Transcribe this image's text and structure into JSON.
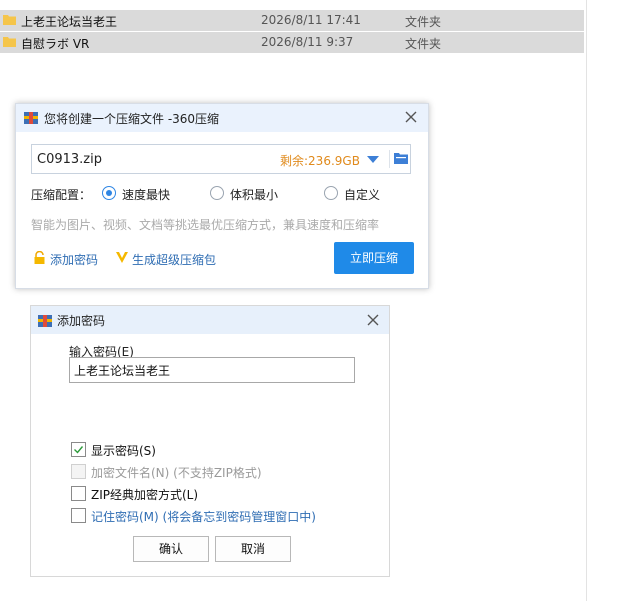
{
  "files": [
    {
      "name": "上老王论坛当老王",
      "date": "2026/8/11 17:41",
      "type": "文件夹"
    },
    {
      "name": "自慰ラボ VR",
      "date": "2026/8/11 9:37",
      "type": "文件夹"
    }
  ],
  "compress_dialog": {
    "title": "您将创建一个压缩文件 -360压缩",
    "filename": "C0913.zip",
    "free_space": "剩余:236.9GB",
    "config_label": "压缩配置：",
    "options": [
      "速度最快",
      "体积最小",
      "自定义"
    ],
    "selected_option": "速度最快",
    "hint": "智能为图片、视频、文档等挑选最优压缩方式，兼具速度和压缩率",
    "add_password": "添加密码",
    "super_package": "生成超级压缩包",
    "compress_now": "立即压缩"
  },
  "password_dialog": {
    "title": "添加密码",
    "input_label": "输入密码(E)",
    "password_value": "上老王论坛当老王",
    "show_password": {
      "label": "显示密码(S)",
      "checked": true
    },
    "encrypt_filenames": {
      "label": "加密文件名(N) (不支持ZIP格式)",
      "checked": false,
      "disabled": true
    },
    "zip_classic": {
      "label": "ZIP经典加密方式(L)",
      "checked": false
    },
    "remember": {
      "label": "记住密码(M) (将会备忘到密码管理窗口中)",
      "checked": false
    },
    "ok": "确认",
    "cancel": "取消"
  },
  "colors": {
    "accent": "#1f8ae8",
    "warning": "#e08a1c",
    "link": "#2f6db3",
    "folder": "#f5c54a"
  }
}
